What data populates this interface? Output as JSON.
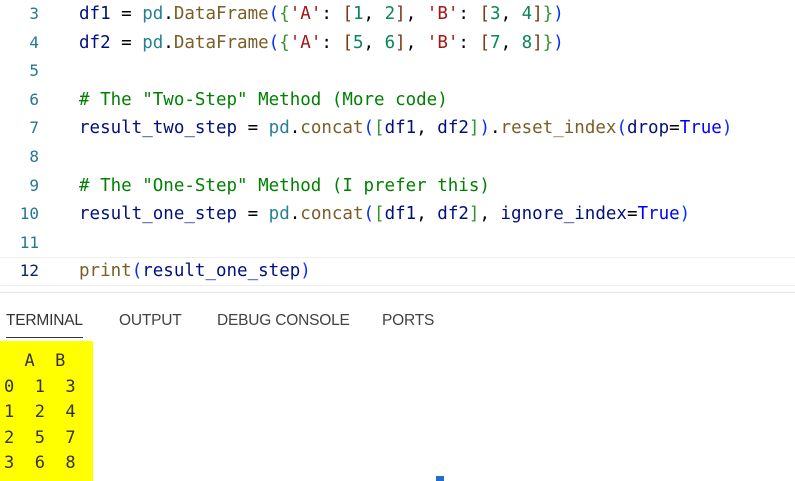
{
  "editor": {
    "lines": [
      {
        "num": "3",
        "tokens": [
          [
            "df1",
            "var"
          ],
          [
            " = ",
            "op"
          ],
          [
            "pd",
            "obj"
          ],
          [
            ".",
            "op"
          ],
          [
            "DataFrame",
            "fn"
          ],
          [
            "(",
            "b1"
          ],
          [
            "{",
            "b2"
          ],
          [
            "'A'",
            "str"
          ],
          [
            ": ",
            "op"
          ],
          [
            "[",
            "b3"
          ],
          [
            "1",
            "num"
          ],
          [
            ", ",
            "op"
          ],
          [
            "2",
            "num"
          ],
          [
            "]",
            "b3"
          ],
          [
            ", ",
            "op"
          ],
          [
            "'B'",
            "str"
          ],
          [
            ": ",
            "op"
          ],
          [
            "[",
            "b3"
          ],
          [
            "3",
            "num"
          ],
          [
            ", ",
            "op"
          ],
          [
            "4",
            "num"
          ],
          [
            "]",
            "b3"
          ],
          [
            "}",
            "b2"
          ],
          [
            ")",
            "b1"
          ]
        ]
      },
      {
        "num": "4",
        "tokens": [
          [
            "df2",
            "var"
          ],
          [
            " = ",
            "op"
          ],
          [
            "pd",
            "obj"
          ],
          [
            ".",
            "op"
          ],
          [
            "DataFrame",
            "fn"
          ],
          [
            "(",
            "b1"
          ],
          [
            "{",
            "b2"
          ],
          [
            "'A'",
            "str"
          ],
          [
            ": ",
            "op"
          ],
          [
            "[",
            "b3"
          ],
          [
            "5",
            "num"
          ],
          [
            ", ",
            "op"
          ],
          [
            "6",
            "num"
          ],
          [
            "]",
            "b3"
          ],
          [
            ", ",
            "op"
          ],
          [
            "'B'",
            "str"
          ],
          [
            ": ",
            "op"
          ],
          [
            "[",
            "b3"
          ],
          [
            "7",
            "num"
          ],
          [
            ", ",
            "op"
          ],
          [
            "8",
            "num"
          ],
          [
            "]",
            "b3"
          ],
          [
            "}",
            "b2"
          ],
          [
            ")",
            "b1"
          ]
        ]
      },
      {
        "num": "5",
        "tokens": []
      },
      {
        "num": "6",
        "tokens": [
          [
            "# The \"Two-Step\" Method (More code)",
            "cmt"
          ]
        ]
      },
      {
        "num": "7",
        "tokens": [
          [
            "result_two_step",
            "var"
          ],
          [
            " = ",
            "op"
          ],
          [
            "pd",
            "obj"
          ],
          [
            ".",
            "op"
          ],
          [
            "concat",
            "fn"
          ],
          [
            "(",
            "b1"
          ],
          [
            "[",
            "b2"
          ],
          [
            "df1",
            "var"
          ],
          [
            ", ",
            "op"
          ],
          [
            "df2",
            "var"
          ],
          [
            "]",
            "b2"
          ],
          [
            ")",
            "b1"
          ],
          [
            ".",
            "op"
          ],
          [
            "reset_index",
            "fn"
          ],
          [
            "(",
            "b1"
          ],
          [
            "drop",
            "var"
          ],
          [
            "=",
            "op"
          ],
          [
            "True",
            "kw"
          ],
          [
            ")",
            "b1"
          ]
        ]
      },
      {
        "num": "8",
        "tokens": []
      },
      {
        "num": "9",
        "tokens": [
          [
            "# The \"One-Step\" Method (I prefer this)",
            "cmt"
          ]
        ]
      },
      {
        "num": "10",
        "tokens": [
          [
            "result_one_step",
            "var"
          ],
          [
            " = ",
            "op"
          ],
          [
            "pd",
            "obj"
          ],
          [
            ".",
            "op"
          ],
          [
            "concat",
            "fn"
          ],
          [
            "(",
            "b1"
          ],
          [
            "[",
            "b2"
          ],
          [
            "df1",
            "var"
          ],
          [
            ", ",
            "op"
          ],
          [
            "df2",
            "var"
          ],
          [
            "]",
            "b2"
          ],
          [
            ", ",
            "op"
          ],
          [
            "ignore_index",
            "var"
          ],
          [
            "=",
            "op"
          ],
          [
            "True",
            "kw"
          ],
          [
            ")",
            "b1"
          ]
        ]
      },
      {
        "num": "11",
        "tokens": []
      },
      {
        "num": "12",
        "tokens": [
          [
            "print",
            "fn"
          ],
          [
            "(",
            "b1"
          ],
          [
            "result_one_step",
            "var"
          ],
          [
            ")",
            "b1"
          ]
        ],
        "current": true
      }
    ]
  },
  "panel": {
    "tabs": [
      {
        "label": "TERMINAL",
        "active": true
      },
      {
        "label": "OUTPUT",
        "active": false
      },
      {
        "label": "DEBUG CONSOLE",
        "active": false
      },
      {
        "label": "PORTS",
        "active": false
      }
    ]
  },
  "terminal": {
    "output_lines": [
      "  A  B",
      "0  1  3",
      "1  2  4",
      "2  5  7",
      "3  6  8"
    ],
    "highlight_color": "#ffff00"
  }
}
